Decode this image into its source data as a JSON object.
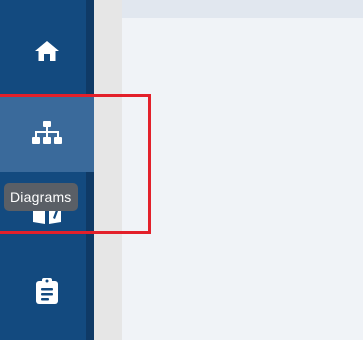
{
  "sidebar": {
    "items": [
      {
        "name": "home",
        "icon": "home-icon",
        "active": false
      },
      {
        "name": "diagrams",
        "icon": "sitemap-icon",
        "active": true
      },
      {
        "name": "docs",
        "icon": "book-icon",
        "active": false
      },
      {
        "name": "tasks",
        "icon": "clipboard-icon",
        "active": false
      }
    ]
  },
  "tooltip": {
    "text": "Diagrams"
  },
  "colors": {
    "sidebar_bg": "#134a7f",
    "active_bg": "#3a6a9b",
    "highlight_border": "#e3202a",
    "tooltip_bg": "#5a5f66",
    "content_bg": "#f0f3f7"
  }
}
